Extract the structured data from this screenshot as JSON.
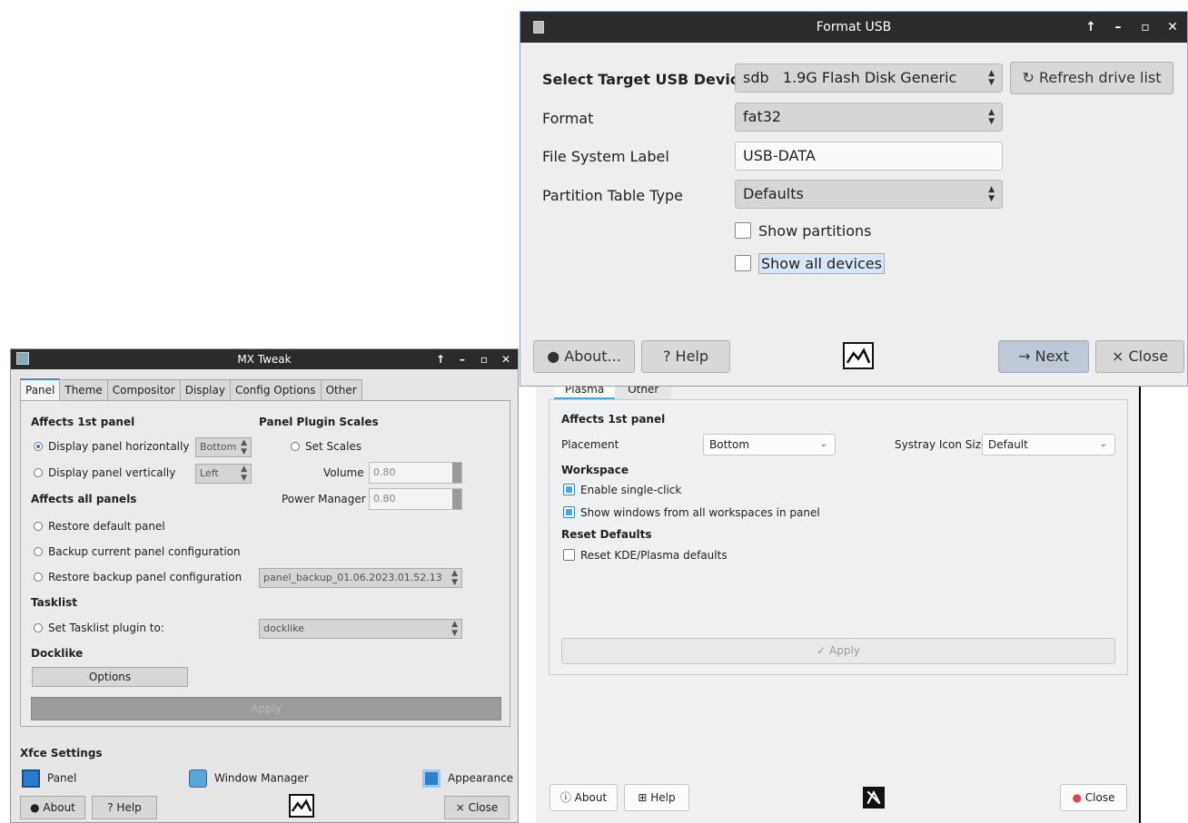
{
  "format_usb": {
    "title": "Format USB",
    "labels": {
      "target_device": "Select Target USB Device",
      "format": "Format",
      "fs_label": "File System Label",
      "partition_table": "Partition Table Type"
    },
    "target_device_value": "sdb   1.9G Flash Disk Generic",
    "refresh_button": "Refresh drive list",
    "format_value": "fat32",
    "fs_label_value": "USB-DATA",
    "partition_table_value": "Defaults",
    "show_partitions": "Show partitions",
    "show_all_devices": "Show all devices",
    "about_button": "About...",
    "help_button": "Help",
    "next_button": "Next",
    "close_button": "Close",
    "icons": {
      "about": "info-icon",
      "help": "question-icon",
      "next": "arrow-right-icon",
      "close": "x-icon",
      "refresh": "refresh-icon"
    }
  },
  "mx_tweak": {
    "title": "MX Tweak",
    "tabs": [
      "Panel",
      "Theme",
      "Compositor",
      "Display",
      "Config Options",
      "Other"
    ],
    "active_tab": "Panel",
    "affects_1st_panel": "Affects 1st panel",
    "panel_plugin_scales": "Panel Plugin Scales",
    "display_horizontally": "Display panel horizontally",
    "horizontal_value": "Bottom",
    "set_scales": "Set Scales",
    "display_vertically": "Display panel vertically",
    "vertical_value": "Left",
    "volume_label": "Volume",
    "volume_value": "0.80",
    "power_manager_label": "Power Manager",
    "power_manager_value": "0.80",
    "affects_all_panels": "Affects all panels",
    "restore_default": "Restore default panel",
    "backup_current": "Backup current panel configuration",
    "restore_backup": "Restore backup panel configuration",
    "backup_value": "panel_backup_01.06.2023.01.52.13",
    "tasklist": "Tasklist",
    "set_tasklist": "Set Tasklist plugin to:",
    "tasklist_value": "docklike",
    "docklike": "Docklike",
    "options_button": "Options",
    "apply_button": "Apply",
    "xfce_settings": "Xfce Settings",
    "xfce_panel": "Panel",
    "xfce_window_manager": "Window Manager",
    "xfce_appearance": "Appearance",
    "about_button": "About",
    "help_button": "Help",
    "close_button": "Close"
  },
  "plasma_tweak": {
    "tabs": [
      "Plasma",
      "Other"
    ],
    "active_tab": "Plasma",
    "affects_1st_panel": "Affects 1st panel",
    "placement_label": "Placement",
    "placement_value": "Bottom",
    "systray_label": "Systray Icon Size",
    "systray_value": "Default",
    "workspace": "Workspace",
    "single_click": "Enable single-click",
    "show_windows": "Show windows from all workspaces in panel",
    "reset_defaults": "Reset Defaults",
    "reset_kde": "Reset KDE/Plasma defaults",
    "apply_button": "Apply",
    "about_button": "About",
    "help_button": "Help",
    "close_button": "Close"
  },
  "colors": {
    "titlebar": "#2b2b2b",
    "accent_blue": "#3daee9",
    "mx_accent": "#2f78c8",
    "close_red": "#da4453"
  }
}
